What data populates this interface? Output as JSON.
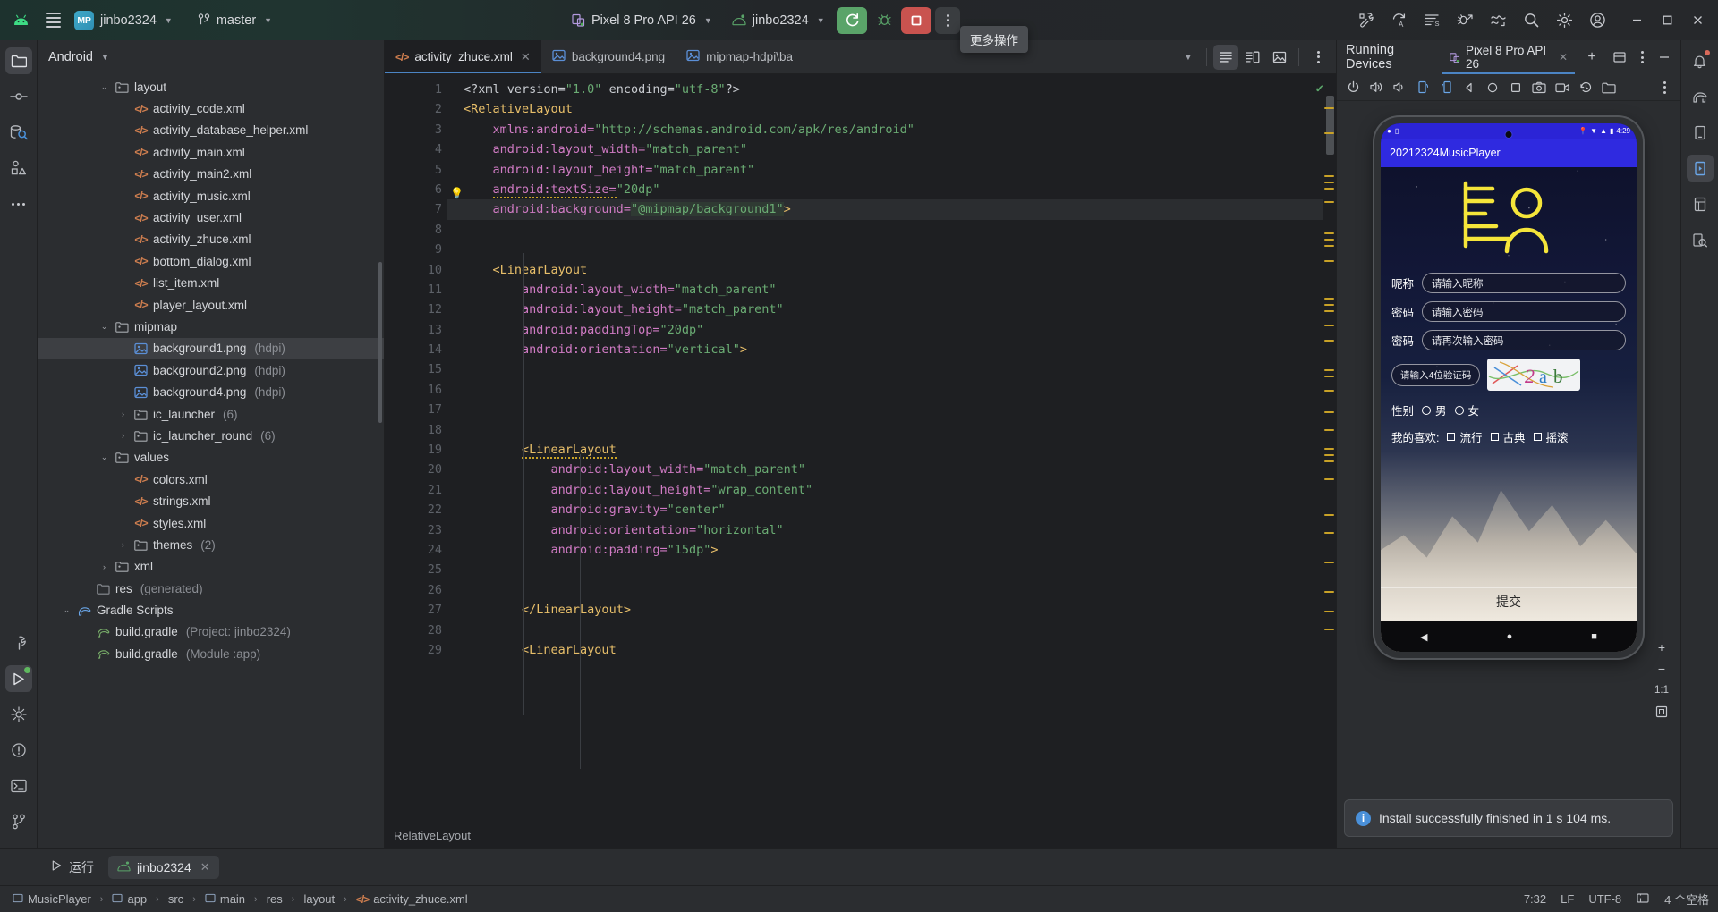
{
  "topbar": {
    "android_icon": "android-robot-icon",
    "menu_icon": "main-menu-icon",
    "project_badge": "MP",
    "project_name": "jinbo2324",
    "branch_icon": "git-branch-icon",
    "branch_name": "master",
    "device_icon": "device-icon",
    "device_name": "Pixel 8 Pro API 26",
    "runconfig_icon": "android-runconfig-icon",
    "runconfig_name": "jinbo2324",
    "run_button": "run-icon",
    "debug_button": "debug-icon",
    "stop_button": "stop-icon",
    "more_button": "more-actions-icon",
    "tooltip": "更多操作",
    "right_icons": [
      "build-icon",
      "sync-gradle-icon",
      "code-format-icon",
      "debug-attach-icon",
      "profiler-icon",
      "search-everywhere-icon",
      "settings-gear-icon",
      "account-icon"
    ],
    "window_controls": [
      "minimize",
      "maximize",
      "close"
    ]
  },
  "left_rail": {
    "items": [
      {
        "name": "project-tool-icon",
        "glyph": "🗀",
        "active": true
      },
      {
        "name": "commit-tool-icon",
        "glyph": "⊶",
        "active": false
      },
      {
        "name": "database-inspector-icon",
        "glyph": "⌸",
        "active": false
      },
      {
        "name": "resource-manager-icon",
        "glyph": "⬠",
        "active": false
      },
      {
        "name": "more-tool-windows-icon",
        "glyph": "⋯",
        "active": false
      }
    ],
    "bottom_items": [
      {
        "name": "build-tool-icon",
        "glyph": "⊤",
        "active": false
      },
      {
        "name": "run-tool-icon",
        "glyph": "▷",
        "active": true,
        "dot": true
      },
      {
        "name": "app-inspection-icon",
        "glyph": "⎈",
        "active": false
      },
      {
        "name": "problems-tool-icon",
        "glyph": "⊙",
        "active": false
      },
      {
        "name": "terminal-tool-icon",
        "glyph": "⌨",
        "active": false
      },
      {
        "name": "version-control-icon",
        "glyph": "⑂",
        "active": false
      }
    ]
  },
  "project": {
    "view_name": "Android",
    "tree": [
      {
        "indent": 2,
        "arrow": "v",
        "icon": "folder",
        "label": "layout",
        "dim": ""
      },
      {
        "indent": 3,
        "arrow": "",
        "icon": "xml",
        "label": "activity_code.xml",
        "dim": ""
      },
      {
        "indent": 3,
        "arrow": "",
        "icon": "xml",
        "label": "activity_database_helper.xml",
        "dim": ""
      },
      {
        "indent": 3,
        "arrow": "",
        "icon": "xml",
        "label": "activity_main.xml",
        "dim": ""
      },
      {
        "indent": 3,
        "arrow": "",
        "icon": "xml",
        "label": "activity_main2.xml",
        "dim": ""
      },
      {
        "indent": 3,
        "arrow": "",
        "icon": "xml",
        "label": "activity_music.xml",
        "dim": ""
      },
      {
        "indent": 3,
        "arrow": "",
        "icon": "xml",
        "label": "activity_user.xml",
        "dim": ""
      },
      {
        "indent": 3,
        "arrow": "",
        "icon": "xml",
        "label": "activity_zhuce.xml",
        "dim": ""
      },
      {
        "indent": 3,
        "arrow": "",
        "icon": "xml",
        "label": "bottom_dialog.xml",
        "dim": ""
      },
      {
        "indent": 3,
        "arrow": "",
        "icon": "xml",
        "label": "list_item.xml",
        "dim": ""
      },
      {
        "indent": 3,
        "arrow": "",
        "icon": "xml",
        "label": "player_layout.xml",
        "dim": ""
      },
      {
        "indent": 2,
        "arrow": "v",
        "icon": "folder",
        "label": "mipmap",
        "dim": ""
      },
      {
        "indent": 3,
        "arrow": "",
        "icon": "img",
        "label": "background1.png",
        "dim": "(hdpi)",
        "selected": true
      },
      {
        "indent": 3,
        "arrow": "",
        "icon": "img",
        "label": "background2.png",
        "dim": "(hdpi)"
      },
      {
        "indent": 3,
        "arrow": "",
        "icon": "img",
        "label": "background4.png",
        "dim": "(hdpi)"
      },
      {
        "indent": 3,
        "arrow": ">",
        "icon": "folder",
        "label": "ic_launcher",
        "dim": "(6)"
      },
      {
        "indent": 3,
        "arrow": ">",
        "icon": "folder",
        "label": "ic_launcher_round",
        "dim": "(6)"
      },
      {
        "indent": 2,
        "arrow": "v",
        "icon": "folder",
        "label": "values",
        "dim": ""
      },
      {
        "indent": 3,
        "arrow": "",
        "icon": "xml",
        "label": "colors.xml",
        "dim": ""
      },
      {
        "indent": 3,
        "arrow": "",
        "icon": "xml",
        "label": "strings.xml",
        "dim": ""
      },
      {
        "indent": 3,
        "arrow": "",
        "icon": "xml",
        "label": "styles.xml",
        "dim": ""
      },
      {
        "indent": 3,
        "arrow": ">",
        "icon": "folder",
        "label": "themes",
        "dim": "(2)"
      },
      {
        "indent": 2,
        "arrow": ">",
        "icon": "folder",
        "label": "xml",
        "dim": ""
      },
      {
        "indent": 1,
        "arrow": "",
        "icon": "folder-gen",
        "label": "res",
        "dim": "(generated)"
      },
      {
        "indent": 0,
        "arrow": "v",
        "icon": "gradle",
        "label": "Gradle Scripts",
        "dim": ""
      },
      {
        "indent": 1,
        "arrow": "",
        "icon": "gradle-file",
        "label": "build.gradle",
        "dim": "(Project: jinbo2324)"
      },
      {
        "indent": 1,
        "arrow": "",
        "icon": "gradle-file",
        "label": "build.gradle",
        "dim": "(Module :app)"
      }
    ]
  },
  "editor": {
    "tabs": [
      {
        "label": "activity_zhuce.xml",
        "icon": "xml-file-icon",
        "active": true,
        "closable": true
      },
      {
        "label": "background4.png",
        "icon": "image-file-icon",
        "active": false,
        "closable": false
      },
      {
        "label": "mipmap-hdpi\\ba",
        "icon": "image-file-icon",
        "active": false,
        "closable": false
      }
    ],
    "tab_actions": [
      "tab-overflow-chevron",
      "text-view-icon",
      "split-view-icon",
      "design-view-icon",
      "editor-options-icon"
    ],
    "status_check": "no-errors-check-icon",
    "breadcrumb": "RelativeLayout",
    "lines": [
      {
        "n": 1,
        "ind": 0,
        "segs": [
          {
            "t": "<?xml version=",
            "c": "pi"
          },
          {
            "t": "\"1.0\"",
            "c": "str"
          },
          {
            "t": " encoding=",
            "c": "pi"
          },
          {
            "t": "\"utf-8\"",
            "c": "str"
          },
          {
            "t": "?>",
            "c": "pi"
          }
        ]
      },
      {
        "n": 2,
        "ind": 0,
        "segs": [
          {
            "t": "<RelativeLayout",
            "c": "tag"
          }
        ]
      },
      {
        "n": 3,
        "ind": 1,
        "segs": [
          {
            "t": "xmlns:android=",
            "c": "attr"
          },
          {
            "t": "\"http://schemas.android.com/apk/res/android\"",
            "c": "str"
          }
        ]
      },
      {
        "n": 4,
        "ind": 1,
        "segs": [
          {
            "t": "android:layout_width=",
            "c": "attr"
          },
          {
            "t": "\"match_parent\"",
            "c": "str"
          }
        ]
      },
      {
        "n": 5,
        "ind": 1,
        "segs": [
          {
            "t": "android:layout_height=",
            "c": "attr"
          },
          {
            "t": "\"match_parent\"",
            "c": "str"
          }
        ]
      },
      {
        "n": 6,
        "ind": 1,
        "gutter": "bulb",
        "warn": true,
        "segs": [
          {
            "t": "android:textSize=",
            "c": "attr"
          },
          {
            "t": "\"20dp\"",
            "c": "str"
          }
        ]
      },
      {
        "n": 7,
        "ind": 1,
        "gutter": "img",
        "hl": true,
        "segs": [
          {
            "t": "android:background=",
            "c": "attr"
          },
          {
            "t": "\"@mipmap/background1\"",
            "c": "str-hl"
          },
          {
            "t": ">",
            "c": "tag"
          }
        ]
      },
      {
        "n": 8,
        "ind": 0,
        "segs": []
      },
      {
        "n": 9,
        "ind": 0,
        "segs": []
      },
      {
        "n": 10,
        "ind": 1,
        "segs": [
          {
            "t": "<LinearLayout",
            "c": "tag"
          }
        ]
      },
      {
        "n": 11,
        "ind": 2,
        "segs": [
          {
            "t": "android:layout_width=",
            "c": "attr"
          },
          {
            "t": "\"match_parent\"",
            "c": "str"
          }
        ]
      },
      {
        "n": 12,
        "ind": 2,
        "segs": [
          {
            "t": "android:layout_height=",
            "c": "attr"
          },
          {
            "t": "\"match_parent\"",
            "c": "str"
          }
        ]
      },
      {
        "n": 13,
        "ind": 2,
        "segs": [
          {
            "t": "android:paddingTop=",
            "c": "attr"
          },
          {
            "t": "\"20dp\"",
            "c": "str"
          }
        ]
      },
      {
        "n": 14,
        "ind": 2,
        "segs": [
          {
            "t": "android:orientation=",
            "c": "attr"
          },
          {
            "t": "\"vertical\"",
            "c": "str"
          },
          {
            "t": ">",
            "c": "tag"
          }
        ]
      },
      {
        "n": 15,
        "ind": 0,
        "segs": []
      },
      {
        "n": 16,
        "ind": 0,
        "segs": []
      },
      {
        "n": 17,
        "ind": 0,
        "segs": []
      },
      {
        "n": 18,
        "ind": 0,
        "segs": []
      },
      {
        "n": 19,
        "ind": 2,
        "warn": true,
        "segs": [
          {
            "t": "<LinearLayout",
            "c": "tag"
          }
        ]
      },
      {
        "n": 20,
        "ind": 3,
        "segs": [
          {
            "t": "android:layout_width=",
            "c": "attr"
          },
          {
            "t": "\"match_parent\"",
            "c": "str"
          }
        ]
      },
      {
        "n": 21,
        "ind": 3,
        "segs": [
          {
            "t": "android:layout_height=",
            "c": "attr"
          },
          {
            "t": "\"wrap_content\"",
            "c": "str"
          }
        ]
      },
      {
        "n": 22,
        "ind": 3,
        "segs": [
          {
            "t": "android:gravity=",
            "c": "attr"
          },
          {
            "t": "\"center\"",
            "c": "str"
          }
        ]
      },
      {
        "n": 23,
        "ind": 3,
        "segs": [
          {
            "t": "android:orientation=",
            "c": "attr"
          },
          {
            "t": "\"horizontal\"",
            "c": "str"
          }
        ]
      },
      {
        "n": 24,
        "ind": 3,
        "segs": [
          {
            "t": "android:padding=",
            "c": "attr"
          },
          {
            "t": "\"15dp\"",
            "c": "str"
          },
          {
            "t": ">",
            "c": "tag"
          }
        ]
      },
      {
        "n": 25,
        "ind": 0,
        "segs": []
      },
      {
        "n": 26,
        "ind": 0,
        "segs": []
      },
      {
        "n": 27,
        "ind": 2,
        "segs": [
          {
            "t": "</LinearLayout>",
            "c": "tag"
          }
        ]
      },
      {
        "n": 28,
        "ind": 0,
        "segs": []
      },
      {
        "n": 29,
        "ind": 2,
        "segs": [
          {
            "t": "<LinearLayout",
            "c": "tag"
          }
        ]
      }
    ]
  },
  "devices": {
    "panel_title": "Running Devices",
    "tab_label": "Pixel 8 Pro API 26",
    "tab_icon": "device-icon",
    "tab_close": "close-icon",
    "add_tab": "add-device-icon",
    "header_icons": [
      "split-window-icon",
      "panel-options-icon",
      "minimize-panel-icon"
    ],
    "toolbar_icons": [
      "power-icon",
      "volume-up-icon",
      "volume-down-icon",
      "rotate-left-icon",
      "rotate-right-icon",
      "back-icon",
      "home-circle-icon",
      "overview-square-icon",
      "screenshot-icon",
      "record-icon",
      "history-icon",
      "folder-device-icon",
      "device-more-icon"
    ],
    "zoom_controls": {
      "zoom_in": "+",
      "zoom_out": "−",
      "zoom_label": "1:1",
      "fit_icon": "fit-to-screen-icon"
    },
    "toast": {
      "icon": "info-icon",
      "message": "Install successfully finished in 1 s 104 ms."
    },
    "emulator": {
      "status_time": "4:29",
      "status_icons": [
        "location-icon",
        "wifi-icon",
        "signal-icon",
        "battery-icon"
      ],
      "app_title": "20212324MusicPlayer",
      "logo": "user-list-icon",
      "fields": [
        {
          "label": "昵称",
          "placeholder": "请输入昵称",
          "name": "nickname-field"
        },
        {
          "label": "密码",
          "placeholder": "请输入密码",
          "name": "password-field"
        },
        {
          "label": "密码",
          "placeholder": "请再次输入密码",
          "name": "confirm-password-field"
        }
      ],
      "captcha_button": "请输入4位验证码",
      "captcha_text": "2ab",
      "gender_label": "性别",
      "gender_options": [
        "男",
        "女"
      ],
      "hobby_label": "我的喜欢:",
      "hobby_options": [
        "流行",
        "古典",
        "摇滚"
      ],
      "submit": "提交",
      "navbar": [
        "back-triangle-icon",
        "home-circle-icon",
        "recents-square-icon"
      ]
    }
  },
  "right_rail": {
    "items": [
      {
        "name": "notifications-icon",
        "glyph": "🔔",
        "dot": true
      },
      {
        "name": "gradle-tool-icon",
        "glyph": "🐘"
      },
      {
        "name": "device-manager-icon",
        "glyph": "▤"
      },
      {
        "name": "running-devices-icon",
        "glyph": "▭",
        "active": true
      },
      {
        "name": "layout-inspector-icon",
        "glyph": "▥"
      },
      {
        "name": "device-explorer-icon",
        "glyph": "⌕"
      }
    ]
  },
  "runbar": {
    "tabs": [
      {
        "label": "运行",
        "icon": "run-tool-icon",
        "active": false,
        "closable": false
      },
      {
        "label": "jinbo2324",
        "icon": "android-runconfig-icon",
        "active": true,
        "closable": true
      }
    ]
  },
  "status": {
    "crumbs": [
      {
        "label": "MusicPlayer",
        "icon": "module-icon"
      },
      {
        "label": "app",
        "icon": "module-icon"
      },
      {
        "label": "src",
        "icon": ""
      },
      {
        "label": "main",
        "icon": "module-icon"
      },
      {
        "label": "res",
        "icon": ""
      },
      {
        "label": "layout",
        "icon": ""
      },
      {
        "label": "activity_zhuce.xml",
        "icon": "xml-file-icon"
      }
    ],
    "caret": "7:32",
    "line_sep": "LF",
    "encoding": "UTF-8",
    "indent": "4 个空格",
    "lock_icon": "read-only-lock-icon"
  },
  "colors": {
    "accent_blue": "#4b84c4",
    "run_green": "#5aa469",
    "stop_red": "#c9534f",
    "xml_orange": "#cf7e4f",
    "app_bar_blue": "#2f2ae0"
  }
}
